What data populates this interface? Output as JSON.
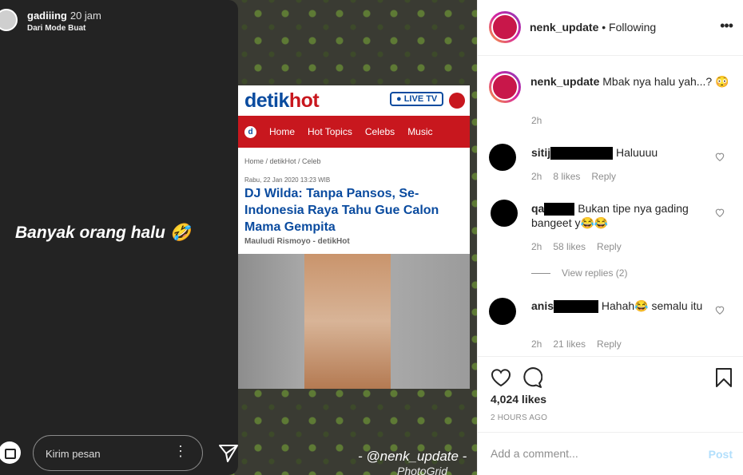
{
  "story": {
    "username": "gadiiing",
    "time": "20 jam",
    "subtitle": "Dari Mode Buat",
    "text": "Banyak orang halu 🤣",
    "reply_placeholder": "Kirim pesan"
  },
  "article": {
    "logo_main": "detik",
    "logo_accent": "hot",
    "live_label": "● LIVE TV",
    "nav_d": "d",
    "nav": [
      "Home",
      "Hot Topics",
      "Celebs",
      "Music"
    ],
    "breadcrumb": "Home / detikHot / Celeb",
    "date": "Rabu, 22 Jan 2020 13:23 WIB",
    "title": "DJ Wilda: Tanpa Pansos, Se-Indonesia Raya Tahu Gue Calon Mama Gempita",
    "author": "Mauludi Rismoyo - detikHot"
  },
  "watermark": "- @nenk_update -",
  "watermark2": "PhotoGrid",
  "post": {
    "username": "nenk_update",
    "following": "• Following",
    "more": "•••",
    "caption_user": "nenk_update",
    "caption": "Mbak nya halu yah...? 😳",
    "caption_time": "2h",
    "likes": "4,024 likes",
    "ago": "2 HOURS AGO",
    "comment_placeholder": "Add a comment...",
    "post_label": "Post"
  },
  "comments": [
    {
      "user": "sitij",
      "text": "Haluuuu",
      "time": "2h",
      "likes": "8 likes",
      "reply": "Reply"
    },
    {
      "user": "qa",
      "text": "Bukan tipe nya gading bangeet y😂😂",
      "time": "2h",
      "likes": "58 likes",
      "reply": "Reply"
    },
    {
      "user": "anis",
      "text": "Hahah😂 semalu itu",
      "time": "2h",
      "likes": "21 likes",
      "reply": "Reply"
    }
  ],
  "view_replies": "View replies (2)",
  "colors": {
    "accent": "#0095f6",
    "detik_red": "#c8171e",
    "detik_blue": "#0a4b9f"
  }
}
